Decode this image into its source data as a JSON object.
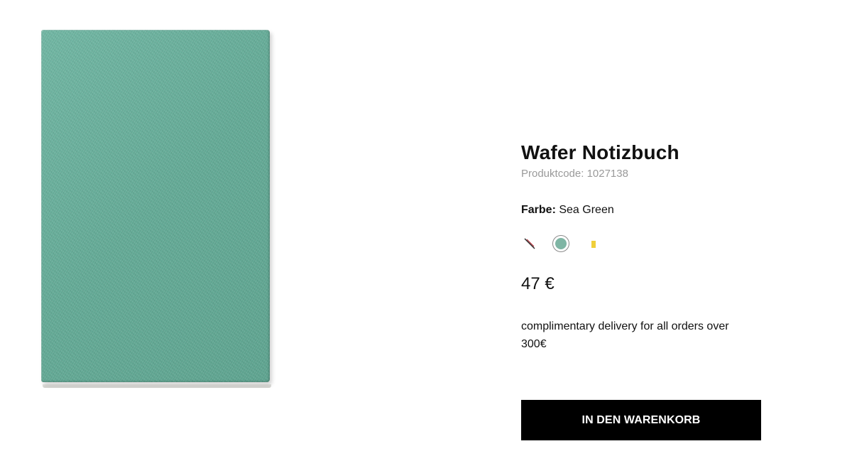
{
  "product": {
    "title": "Wafer Notizbuch",
    "code_label": "Produktcode:",
    "code_value": "1027138",
    "color_label": "Farbe:",
    "color_value": "Sea Green",
    "price": "47 €",
    "delivery_note": "complimentary delivery for all orders over 300€",
    "image_color": "#6bb29e"
  },
  "swatches": [
    {
      "name": "unavailable-swatch",
      "icon": "slash-icon",
      "color": "#b5303a"
    },
    {
      "name": "sea-green",
      "selected": true,
      "color": "#7fb5a4"
    },
    {
      "name": "yellow",
      "color": "#f0cf3a"
    }
  ],
  "cart_button": {
    "label": "IN DEN WARENKORB"
  }
}
